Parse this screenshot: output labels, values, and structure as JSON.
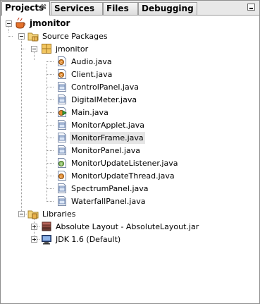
{
  "tabs": [
    {
      "label": "Projects",
      "close": "⌘"
    },
    {
      "label": "Services"
    },
    {
      "label": "Files"
    },
    {
      "label": "Debugging"
    }
  ],
  "project": {
    "name": "jmonitor",
    "source_packages": "Source Packages",
    "package": "jmonitor",
    "files": [
      {
        "name": "Audio.java",
        "icon": "java-class-icon"
      },
      {
        "name": "Client.java",
        "icon": "java-class-icon"
      },
      {
        "name": "ControlPanel.java",
        "icon": "java-form-icon"
      },
      {
        "name": "DigitalMeter.java",
        "icon": "java-form-icon"
      },
      {
        "name": "Main.java",
        "icon": "java-main-class-icon"
      },
      {
        "name": "MonitorApplet.java",
        "icon": "java-form-icon"
      },
      {
        "name": "MonitorFrame.java",
        "icon": "java-form-icon"
      },
      {
        "name": "MonitorPanel.java",
        "icon": "java-form-icon"
      },
      {
        "name": "MonitorUpdateListener.java",
        "icon": "java-interface-icon"
      },
      {
        "name": "MonitorUpdateThread.java",
        "icon": "java-class-icon"
      },
      {
        "name": "SpectrumPanel.java",
        "icon": "java-form-icon"
      },
      {
        "name": "WaterfallPanel.java",
        "icon": "java-form-icon"
      }
    ],
    "libraries": "Libraries",
    "library_items": [
      {
        "name": "Absolute Layout - AbsoluteLayout.jar",
        "icon": "jar-library-icon"
      },
      {
        "name": "JDK 1.6 (Default)",
        "icon": "jdk-platform-icon"
      }
    ]
  },
  "selected_file": "MonitorFrame.java",
  "colors": {
    "selection": "#e6e6e6",
    "tab_active": "#ffffff",
    "border": "#8e8e8e"
  }
}
